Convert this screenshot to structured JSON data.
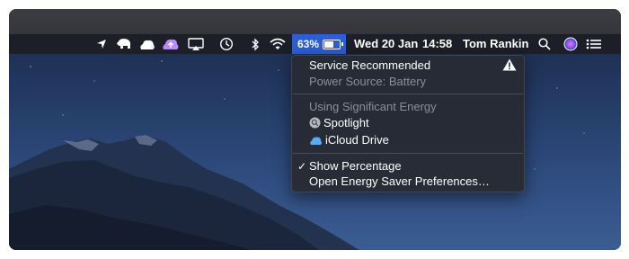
{
  "menubar": {
    "battery_percent": "63%",
    "battery_level": 0.63,
    "date": "Wed 20 Jan",
    "time": "14:58",
    "user": "Tom Rankin",
    "icons": [
      "location-arrow-icon",
      "evernote-elephant-icon",
      "cloud-app-icon",
      "cloud-upload-icon",
      "airplay-icon",
      "time-machine-icon",
      "bluetooth-icon",
      "wifi-icon",
      "battery-icon",
      "spotlight-search-icon",
      "siri-icon",
      "notification-center-icon"
    ]
  },
  "battery_menu": {
    "condition": "Service Recommended",
    "power_source": "Power Source: Battery",
    "energy_header": "Using Significant Energy",
    "apps": [
      {
        "name": "Spotlight",
        "icon": "spotlight-app-icon"
      },
      {
        "name": "iCloud Drive",
        "icon": "icloud-drive-icon"
      }
    ],
    "show_percentage": "Show Percentage",
    "show_percentage_checked": true,
    "open_prefs": "Open Energy Saver Preferences…",
    "warning_icon": "warning-triangle-icon"
  },
  "colors": {
    "highlight": "#2b5fd6",
    "menubar_bg": "#1c1e24",
    "menu_bg": "#282b34"
  }
}
